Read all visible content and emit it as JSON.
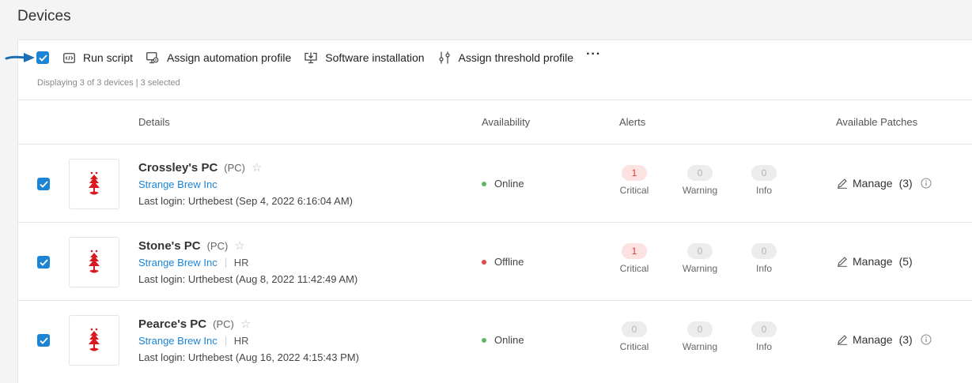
{
  "page": {
    "title": "Devices"
  },
  "toolbar": {
    "run_script": "Run script",
    "assign_automation": "Assign automation profile",
    "software_install": "Software installation",
    "assign_threshold": "Assign threshold profile",
    "more": "···"
  },
  "selection": {
    "summary": "Displaying 3 of 3 devices | 3 selected"
  },
  "columns": {
    "details": "Details",
    "availability": "Availability",
    "alerts": "Alerts",
    "patches": "Available Patches"
  },
  "alert_labels": {
    "critical": "Critical",
    "warning": "Warning",
    "info": "Info"
  },
  "colors": {
    "accent": "#1b84d4",
    "online": "#5cb85c",
    "offline": "#e5484d",
    "critical": "#d9383a"
  },
  "devices": [
    {
      "name": "Crossley's PC",
      "type": "(PC)",
      "org": "Strange Brew Inc",
      "dept": "",
      "last_login": "Last login: Urthebest (Sep 4, 2022 6:16:04 AM)",
      "status": "Online",
      "alerts": {
        "critical": "1",
        "warning": "0",
        "info": "0"
      },
      "manage": "Manage",
      "patch_count": "(3)",
      "has_info": true
    },
    {
      "name": "Stone's PC",
      "type": "(PC)",
      "org": "Strange Brew Inc",
      "dept": "HR",
      "last_login": "Last login: Urthebest (Aug 8, 2022 11:42:49 AM)",
      "status": "Offline",
      "alerts": {
        "critical": "1",
        "warning": "0",
        "info": "0"
      },
      "manage": "Manage",
      "patch_count": "(5)",
      "has_info": false
    },
    {
      "name": "Pearce's PC",
      "type": "(PC)",
      "org": "Strange Brew Inc",
      "dept": "HR",
      "last_login": "Last login: Urthebest (Aug 16, 2022 4:15:43 PM)",
      "status": "Online",
      "alerts": {
        "critical": "0",
        "warning": "0",
        "info": "0"
      },
      "manage": "Manage",
      "patch_count": "(3)",
      "has_info": true
    }
  ]
}
